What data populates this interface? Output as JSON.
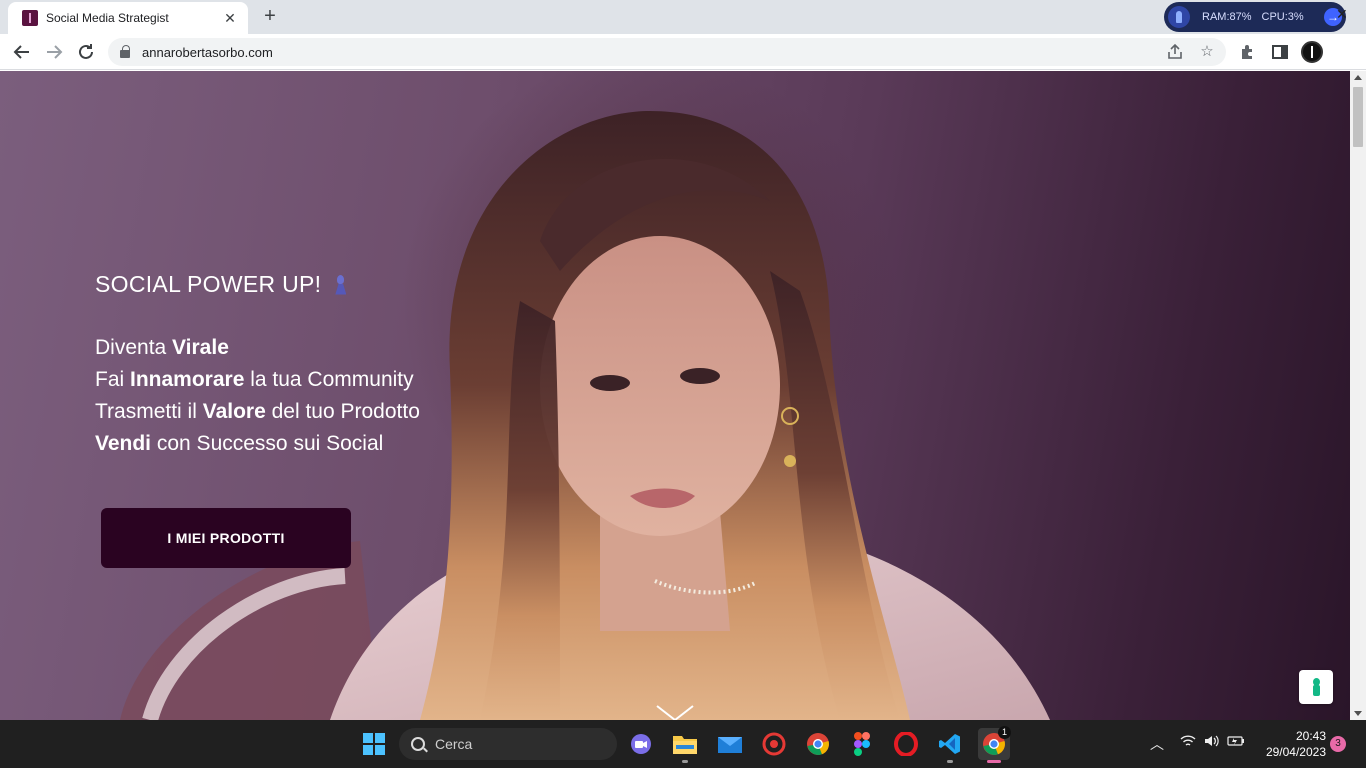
{
  "browser": {
    "tab": {
      "title": "Social Media Strategist",
      "close_label": "✕"
    },
    "new_tab_label": "+",
    "system_monitor": {
      "ram": "RAM:87%",
      "cpu": "CPU:3%"
    },
    "window_close_label": "✕",
    "address": "annarobertasorbo.com"
  },
  "hero": {
    "heading": "SOCIAL POWER UP!",
    "lines": [
      {
        "pre": "Diventa ",
        "bold": "Virale",
        "post": ""
      },
      {
        "pre": "Fai ",
        "bold": "Innamorare",
        "post": " la tua Community"
      },
      {
        "pre": "Trasmetti il ",
        "bold": "Valore",
        "post": " del tuo Prodotto"
      },
      {
        "pre": "",
        "bold": "Vendi",
        "post": " con Successo sui Social"
      }
    ],
    "cta_label": "I MIEI PRODOTTI"
  },
  "taskbar": {
    "search_placeholder": "Cerca",
    "apps": [
      "start",
      "search",
      "meet",
      "file-explorer",
      "mail",
      "app-red",
      "chrome",
      "figma",
      "opera",
      "vscode",
      "chrome-active"
    ],
    "active_badge": "1",
    "time": "20:43",
    "date": "29/04/2023",
    "notifications": "3"
  }
}
